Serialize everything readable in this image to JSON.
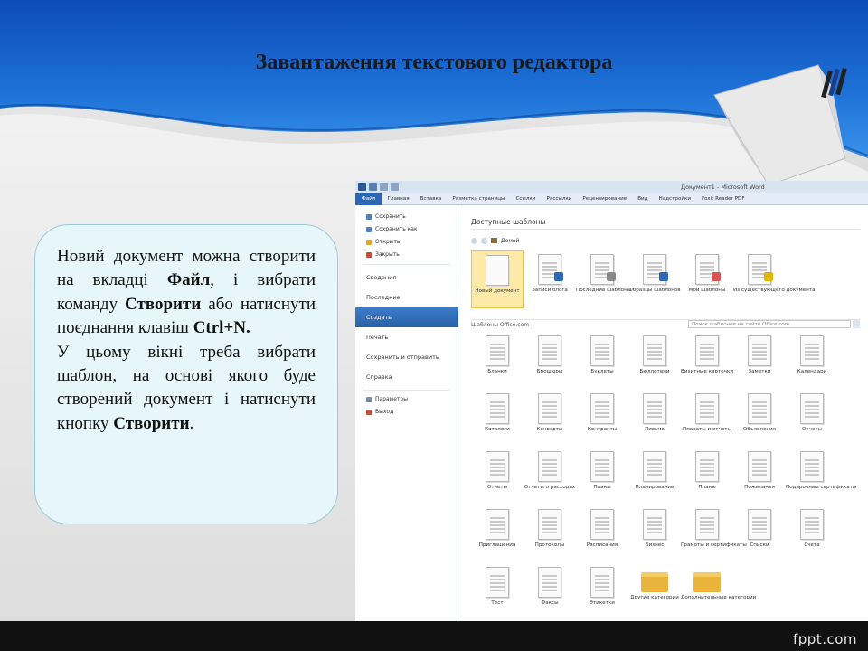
{
  "slide": {
    "title": "Завантаження текстового редактора",
    "callout": {
      "p1_a": "Новий документ можна створити на вкладці ",
      "p1_b": "Файл",
      "p1_c": ", і вибрати команду ",
      "p1_d": "Створити",
      "p1_e": " або натиснути поєднання клавіш ",
      "p1_f": "Ctrl+N",
      "p1_g": ".",
      "p2_a": "У цьому вікні треба вибрати шаблон, на основі якого буде створений документ і натиснути кнопку ",
      "p2_b": "Створити",
      "p2_c": "."
    },
    "watermark": "fppt.com"
  },
  "colors": {
    "slide_blue": "#1e63c8",
    "dark_blue": "#0b3f9a",
    "callout_bg": "#e7f6fa",
    "file_tab": "#2a67b7",
    "selected_tile": "#fde9a8"
  },
  "word": {
    "title": "Документ1 - Microsoft Word",
    "tabs": [
      "Файл",
      "Главная",
      "Вставка",
      "Разметка страницы",
      "Ссылки",
      "Рассылки",
      "Рецензирование",
      "Вид",
      "Надстройки",
      "Foxit Reader PDF"
    ],
    "menu_items": [
      {
        "label": "Сохранить",
        "icon": "save-icon"
      },
      {
        "label": "Сохранить как",
        "icon": "save-as-icon"
      },
      {
        "label": "Открыть",
        "icon": "open-folder-icon"
      },
      {
        "label": "Закрыть",
        "icon": "close-doc-icon"
      }
    ],
    "menu_sections": [
      "Сведения",
      "Последние",
      "Создать",
      "Печать",
      "Сохранить и отправить",
      "Справка"
    ],
    "menu_bottom": [
      {
        "label": "Параметры",
        "icon": "options-icon"
      },
      {
        "label": "Выход",
        "icon": "exit-icon"
      }
    ],
    "heading": "Доступные шаблоны",
    "nav_home": "Домой",
    "top_templates": [
      "Новый документ",
      "Записи блога",
      "Последние шаблоны",
      "Образцы шаблонов",
      "Мои шаблоны",
      "Из существующего документа"
    ],
    "office_label": "Шаблоны Office.com",
    "search_placeholder": "Поиск шаблонов на сайте Office.com",
    "office_templates": [
      [
        "Бланки",
        "Брошюры",
        "Буклеты",
        "Бюллетени",
        "Визитные карточки",
        "Заметки",
        "Календари"
      ],
      [
        "Каталоги",
        "Конверты",
        "Контракты",
        "Письма",
        "Плакаты и отчеты",
        "Объявления",
        "Отчеты"
      ],
      [
        "Отчеты",
        "Отчеты о расходах",
        "Планы",
        "Планирование",
        "Планы",
        "Пожелания",
        "Подарочные сертификаты"
      ],
      [
        "Приглашения",
        "Протоколы",
        "Расписания",
        "Бизнес",
        "Грамоты и сертификаты",
        "Списки",
        "Счета"
      ],
      [
        "Тест",
        "Факсы",
        "Этикетки",
        "Другие категории",
        "Дополнительные категории"
      ]
    ]
  }
}
